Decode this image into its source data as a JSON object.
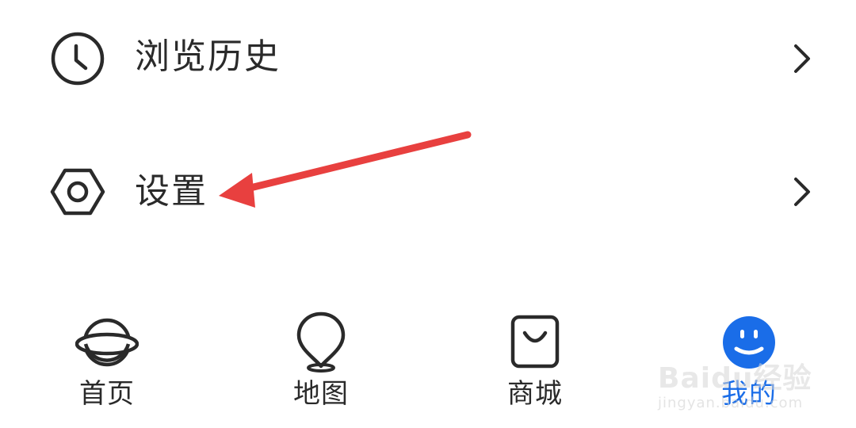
{
  "menu": {
    "items": [
      {
        "label": "浏览历史",
        "icon": "clock-icon"
      },
      {
        "label": "设置",
        "icon": "hexagon-settings-icon"
      }
    ]
  },
  "tabbar": {
    "tabs": [
      {
        "label": "首页",
        "icon": "planet-icon",
        "active": false
      },
      {
        "label": "地图",
        "icon": "map-pin-icon",
        "active": false
      },
      {
        "label": "商城",
        "icon": "shopping-bag-icon",
        "active": false
      },
      {
        "label": "我的",
        "icon": "smiley-face-icon",
        "active": true
      }
    ]
  },
  "annotation": {
    "type": "arrow",
    "color": "#e8403f",
    "points_to": "设置"
  },
  "watermark": {
    "brand": "Baidu经验",
    "site": "jingyan.baidu.com"
  },
  "colors": {
    "text": "#2a2a2a",
    "accent": "#1a6de8",
    "arrow": "#e8403f"
  }
}
